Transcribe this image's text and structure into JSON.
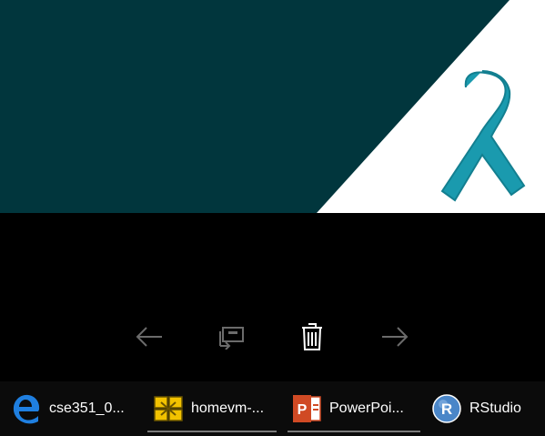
{
  "preview": {
    "background_color": "#01363d",
    "corner_color": "#ffffff",
    "ribbon_color": "#1a9aae"
  },
  "controls": {
    "previous_icon": "arrow-left-icon",
    "cast_icon": "cast-to-device-icon",
    "delete_icon": "trash-icon",
    "next_icon": "arrow-right-icon"
  },
  "taskbar": {
    "items": [
      {
        "label": "cse351_0...",
        "icon": "edge-icon"
      },
      {
        "label": "homevm-...",
        "icon": "vmware-icon"
      },
      {
        "label": "PowerPoi...",
        "icon": "powerpoint-icon"
      },
      {
        "label": "RStudio",
        "icon": "rstudio-icon"
      }
    ]
  }
}
